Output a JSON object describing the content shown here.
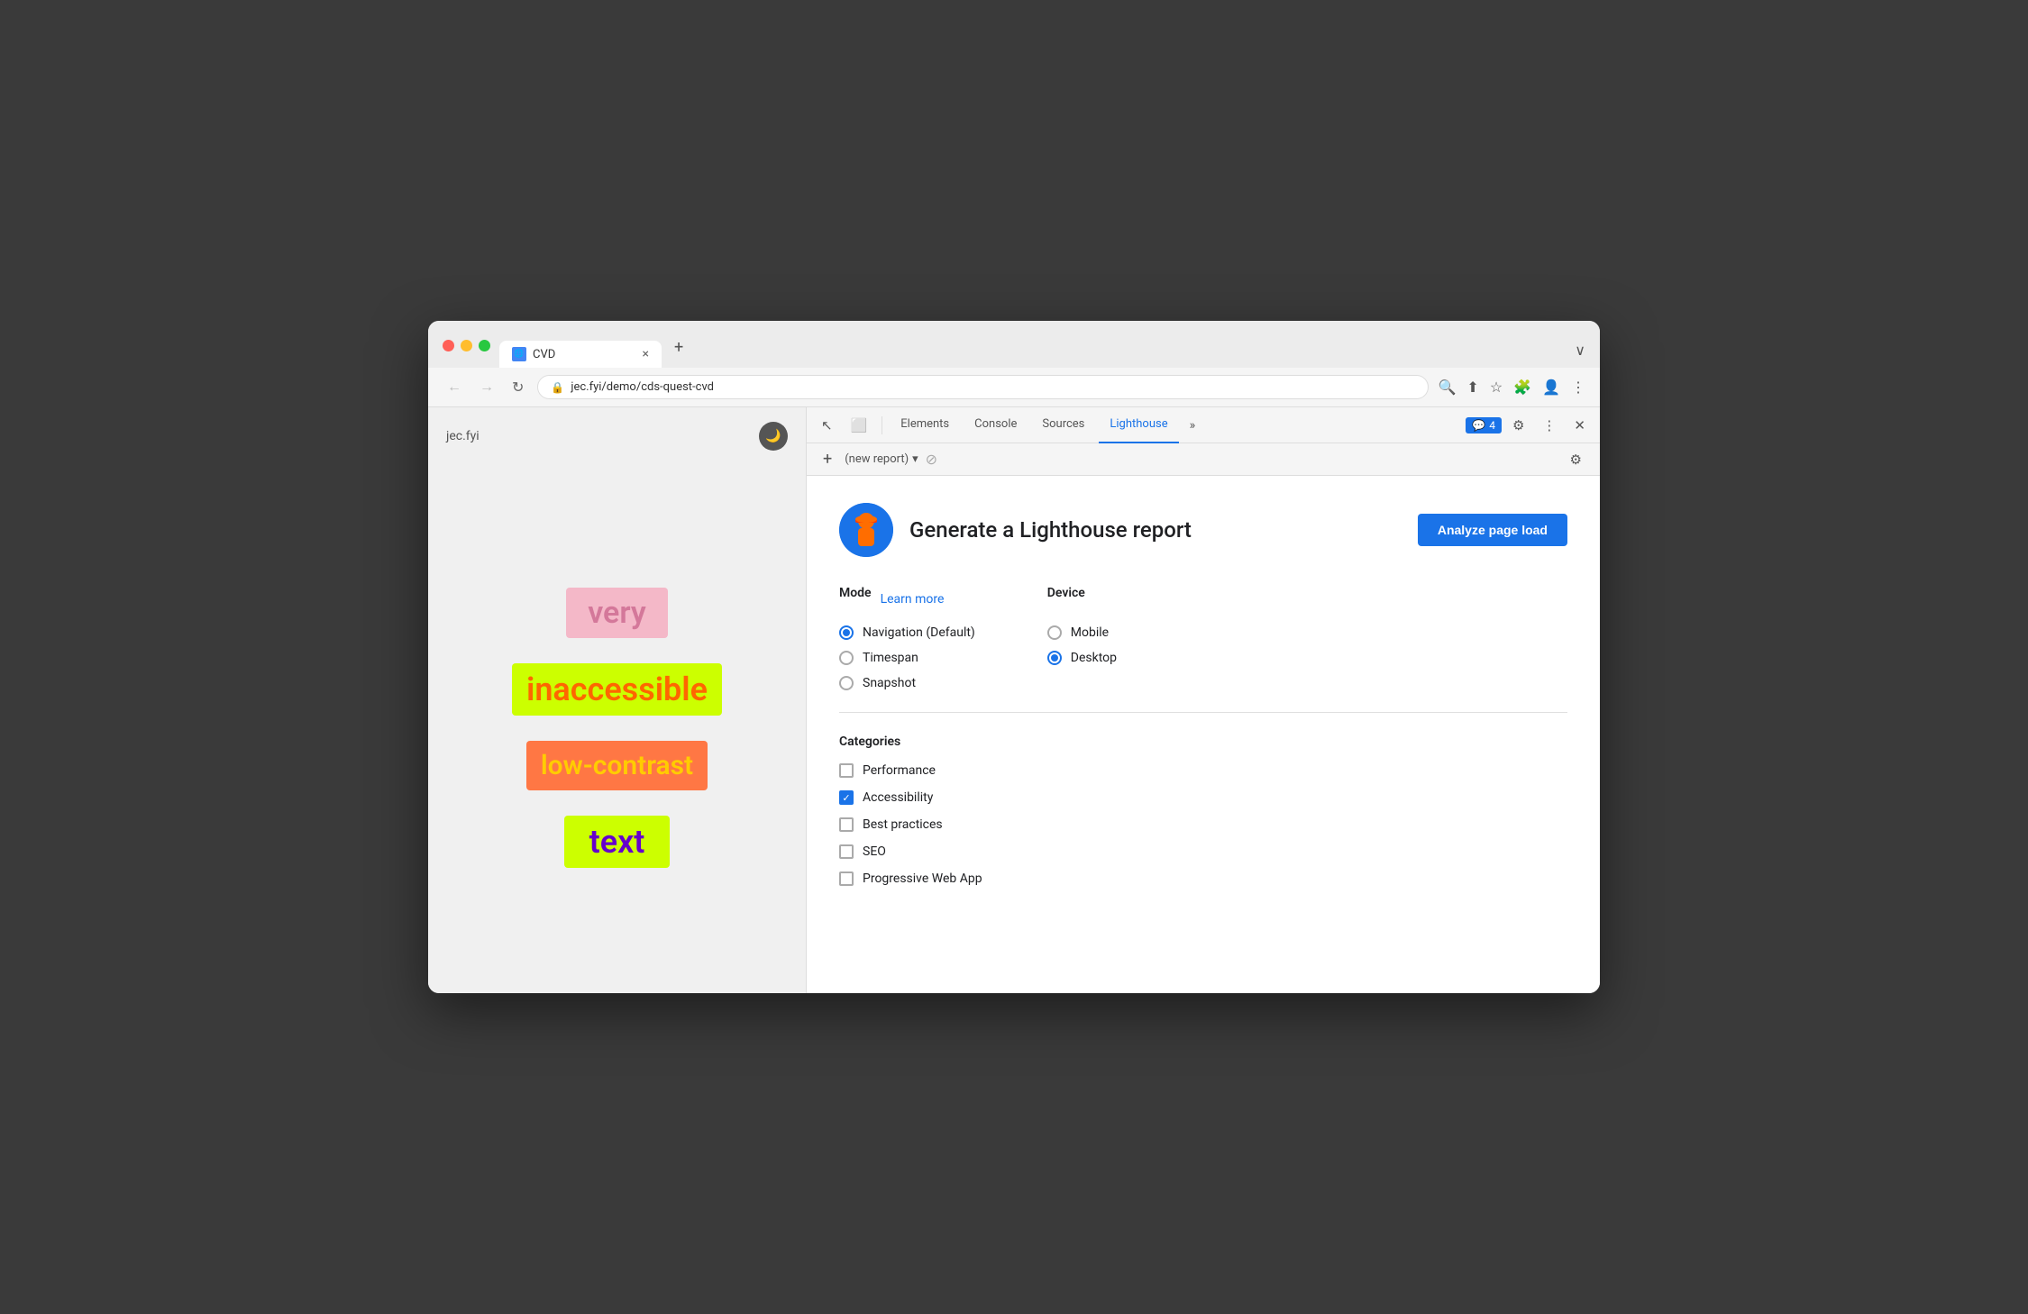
{
  "browser": {
    "tab_title": "CVD",
    "tab_favicon": "🌐",
    "tab_close": "×",
    "new_tab_btn": "+",
    "tab_overflow": "∨",
    "nav_back": "←",
    "nav_forward": "→",
    "nav_refresh": "↻",
    "address_url": "jec.fyi/demo/cds-quest-cvd",
    "lock_icon": "🔒"
  },
  "webpage": {
    "logo": "jec.fyi",
    "dark_mode_icon": "🌙",
    "words": [
      {
        "text": "very",
        "class": "word-very"
      },
      {
        "text": "inaccessible",
        "class": "word-inaccessible"
      },
      {
        "text": "low-contrast",
        "class": "word-low-contrast"
      },
      {
        "text": "text",
        "class": "word-text"
      }
    ]
  },
  "devtools": {
    "toolbar": {
      "inspect_icon": "↖",
      "device_icon": "⬜",
      "tabs": [
        "Elements",
        "Console",
        "Sources",
        "Lighthouse"
      ],
      "active_tab": "Lighthouse",
      "more_icon": "»",
      "badge_icon": "💬",
      "badge_count": "4",
      "settings_icon": "⚙",
      "more_dots": "⋮",
      "close_icon": "✕"
    },
    "secondary_bar": {
      "add_icon": "+",
      "report_placeholder": "(new report)",
      "dropdown_icon": "▾",
      "no_icon": "⊘",
      "settings_icon": "⚙"
    },
    "lighthouse": {
      "icon_emoji": "🏠",
      "title": "Generate a Lighthouse report",
      "analyze_btn": "Analyze page load",
      "mode_label": "Mode",
      "learn_more": "Learn more",
      "mode_options": [
        {
          "label": "Navigation (Default)",
          "checked": true
        },
        {
          "label": "Timespan",
          "checked": false
        },
        {
          "label": "Snapshot",
          "checked": false
        }
      ],
      "device_label": "Device",
      "device_options": [
        {
          "label": "Mobile",
          "checked": false
        },
        {
          "label": "Desktop",
          "checked": true
        }
      ],
      "categories_label": "Categories",
      "categories": [
        {
          "label": "Performance",
          "checked": false
        },
        {
          "label": "Accessibility",
          "checked": true
        },
        {
          "label": "Best practices",
          "checked": false
        },
        {
          "label": "SEO",
          "checked": false
        },
        {
          "label": "Progressive Web App",
          "checked": false
        }
      ]
    }
  }
}
